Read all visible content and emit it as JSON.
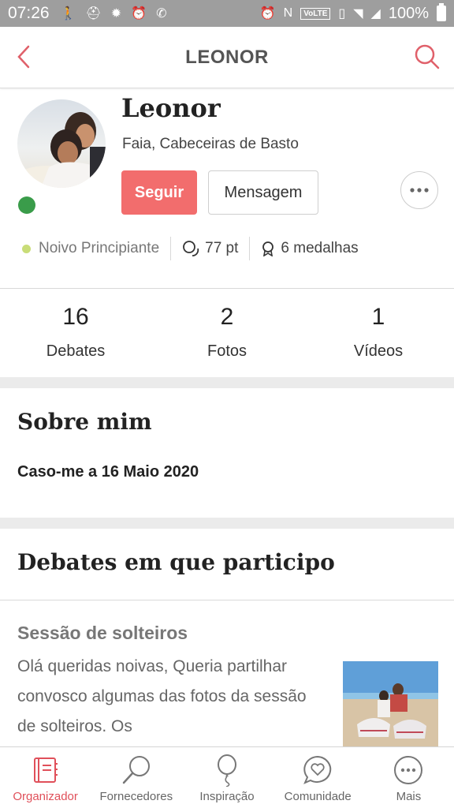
{
  "status_bar": {
    "time": "07:26",
    "network_label": "VoLTE",
    "battery": "100%"
  },
  "header": {
    "title": "LEONOR",
    "back_icon": "chevron-left-icon",
    "search_icon": "search-icon"
  },
  "profile": {
    "name": "Leonor",
    "location": "Faia, Cabeceiras de Basto",
    "follow_label": "Seguir",
    "message_label": "Mensagem",
    "status": "online",
    "rank": "Noivo Principiante",
    "points": "77 pt",
    "medals": "6 medalhas"
  },
  "stats": [
    {
      "value": "16",
      "label": "Debates"
    },
    {
      "value": "2",
      "label": "Fotos"
    },
    {
      "value": "1",
      "label": "Vídeos"
    }
  ],
  "about": {
    "title": "Sobre mim",
    "text": "Caso-me a 16 Maio 2020"
  },
  "debates": {
    "title": "Debates em que participo",
    "post": {
      "title": "Sessão de solteiros",
      "excerpt": "Olá queridas noivas, Queria partilhar convosco algumas das fotos da sessão de solteiros. Os"
    }
  },
  "bottom_nav": [
    {
      "label": "Organizador",
      "icon": "planner-icon",
      "active": true
    },
    {
      "label": "Fornecedores",
      "icon": "search-icon",
      "active": false
    },
    {
      "label": "Inspiração",
      "icon": "balloon-icon",
      "active": false
    },
    {
      "label": "Comunidade",
      "icon": "heart-chat-icon",
      "active": false
    },
    {
      "label": "Mais",
      "icon": "more-icon",
      "active": false
    }
  ],
  "colors": {
    "accent": "#f26d6d",
    "online": "#3a9c4a",
    "rank_dot": "#c9dd78",
    "status_bar": "#9e9e9e"
  }
}
